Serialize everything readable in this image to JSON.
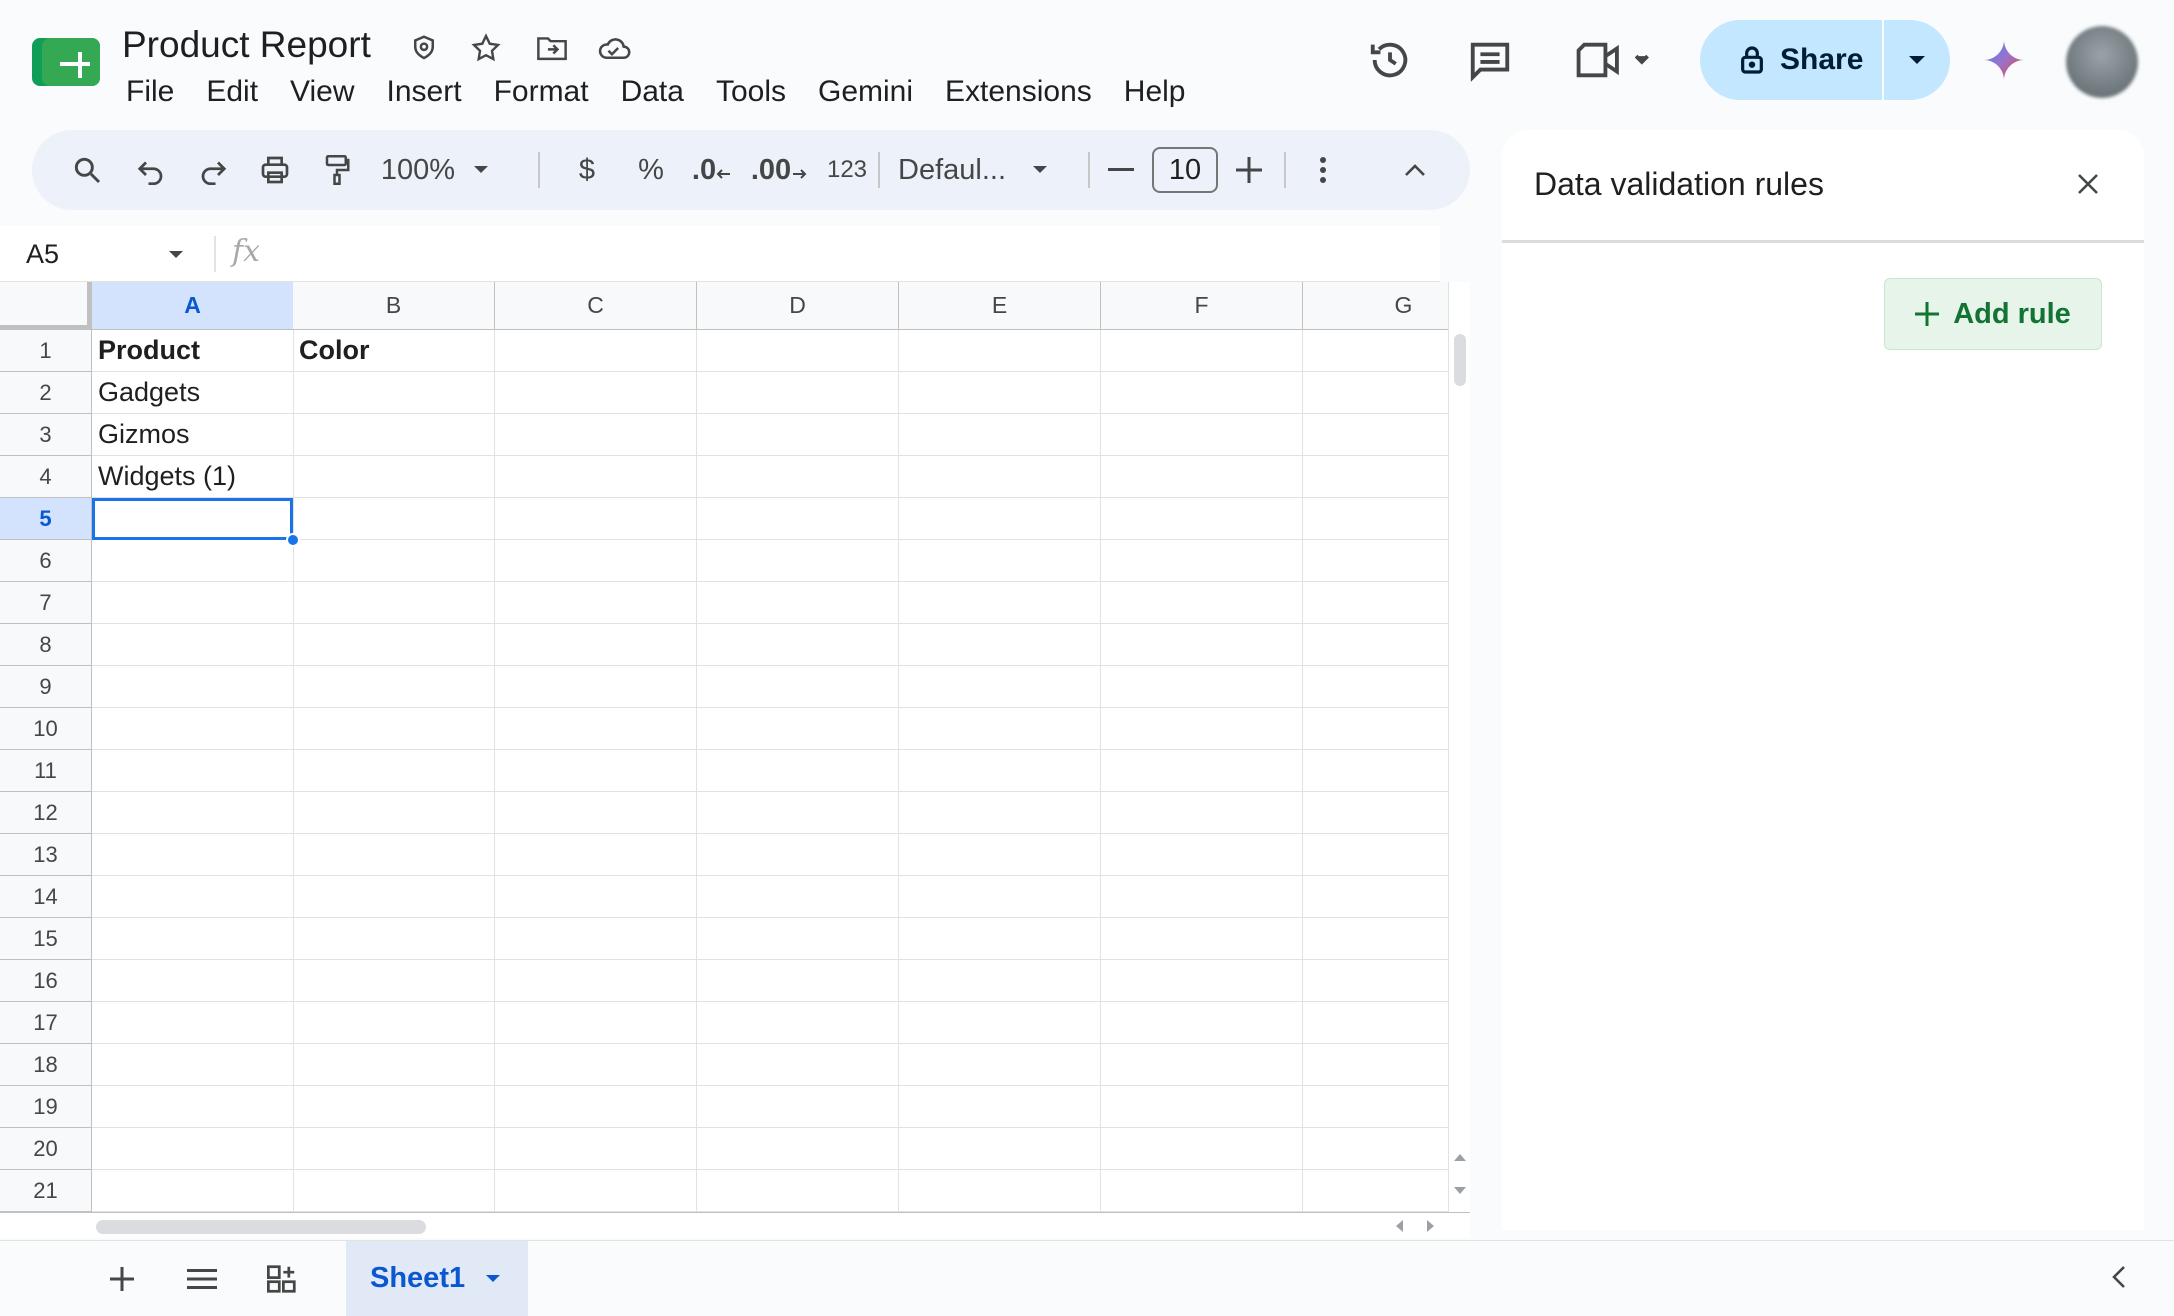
{
  "document": {
    "title": "Product Report",
    "title_icons": [
      "shield-icon",
      "star-icon",
      "move-folder-icon",
      "cloud-saved-icon"
    ]
  },
  "menu": [
    "File",
    "Edit",
    "View",
    "Insert",
    "Format",
    "Data",
    "Tools",
    "Gemini",
    "Extensions",
    "Help"
  ],
  "header_actions": {
    "share_label": "Share",
    "icons": [
      "version-history-icon",
      "comments-icon",
      "meet-icon",
      "gemini-icon",
      "avatar"
    ]
  },
  "toolbar": {
    "zoom": "100%",
    "currency": "$",
    "percent": "%",
    "decrease_decimal": ".0",
    "increase_decimal": ".00",
    "number_format": "123",
    "font": "Defaul...",
    "font_size": "10"
  },
  "formula_bar": {
    "cell_ref": "A5",
    "fx": "fx",
    "value": ""
  },
  "grid": {
    "columns": [
      "A",
      "B",
      "C",
      "D",
      "E",
      "F",
      "G"
    ],
    "selected_column": "A",
    "rows": [
      "1",
      "2",
      "3",
      "4",
      "5",
      "6",
      "7",
      "8",
      "9",
      "10",
      "11",
      "12",
      "13",
      "14",
      "15",
      "16",
      "17",
      "18",
      "19",
      "20",
      "21"
    ],
    "selected_row": "5",
    "cells": {
      "A1": "Product",
      "B1": "Color",
      "A2": "Gadgets",
      "A3": "Gizmos",
      "A4": "Widgets (1)"
    }
  },
  "sheets": {
    "active": "Sheet1"
  },
  "side_panel": {
    "title": "Data validation rules",
    "add_rule_label": "Add rule"
  },
  "colors": {
    "accent": "#0b57d0",
    "share_bg": "#c2e7ff",
    "selection": "#1a73e8",
    "add_rule_bg": "#e6f4ea",
    "add_rule_text": "#137333"
  }
}
